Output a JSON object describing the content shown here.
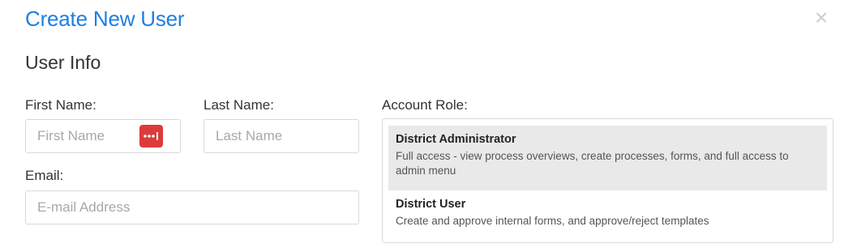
{
  "modal": {
    "title": "Create New User",
    "close_icon": "close-icon"
  },
  "user_info": {
    "section_title": "User Info",
    "first_name": {
      "label": "First Name:",
      "placeholder": "First Name",
      "value": ""
    },
    "last_name": {
      "label": "Last Name:",
      "placeholder": "Last Name",
      "value": ""
    },
    "email": {
      "label": "Email:",
      "placeholder": "E-mail Address",
      "value": ""
    },
    "password_manager_icon": "password-manager-icon",
    "password_manager_color": "#dc3b3b"
  },
  "account_role": {
    "label": "Account Role:",
    "options": [
      {
        "name": "District Administrator",
        "description": "Full access - view process overviews, create processes, forms, and full access to admin menu",
        "selected": true
      },
      {
        "name": "District User",
        "description": "Create and approve internal forms, and approve/reject templates",
        "selected": false
      }
    ]
  },
  "colors": {
    "title": "#1e7fe0",
    "selected_background": "#e9e9e9"
  }
}
